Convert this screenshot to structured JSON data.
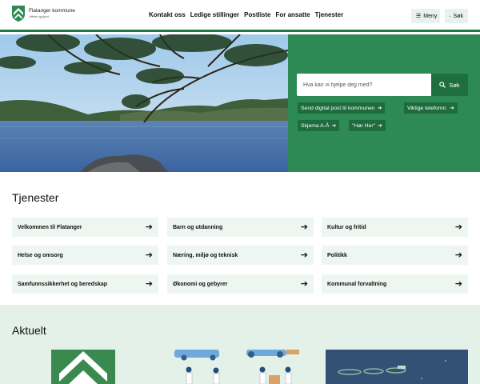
{
  "header": {
    "logo_name": "Flatanger kommune",
    "logo_tagline": "Utfrist og fjord",
    "nav": [
      "Kontakt oss",
      "Ledige stillinger",
      "Postliste",
      "For ansatte",
      "Tjenester"
    ],
    "menu_label": "Meny",
    "search_label": "Søk"
  },
  "hero": {
    "search_placeholder": "Hva kan vi hjelpe deg med?",
    "search_button": "Søk",
    "quick_links": [
      "Send digital post til kommunen",
      "Viktige telefonnr.",
      "Skjema A-Å",
      "\"Hør Her\""
    ]
  },
  "tjenester": {
    "title": "Tjenester",
    "items": [
      "Velkommen til Flatanger",
      "Barn og utdanning",
      "Kultur og fritid",
      "Helse og omsorg",
      "Næring, miljø og teknisk",
      "Politikk",
      "Samfunnssikkerhet og beredskap",
      "Økonomi og gebyrer",
      "Kommunal forvaltning"
    ]
  },
  "aktuelt": {
    "title": "Aktuelt"
  },
  "colors": {
    "brand_green": "#2e8a55",
    "dark_green": "#1e6b3c",
    "tile_bg": "#eef6f1",
    "aktuelt_bg": "#e3f1e8"
  },
  "icons": {
    "search": "magnifier-icon",
    "menu": "hamburger-icon",
    "arrow": "arrow-right-icon"
  }
}
